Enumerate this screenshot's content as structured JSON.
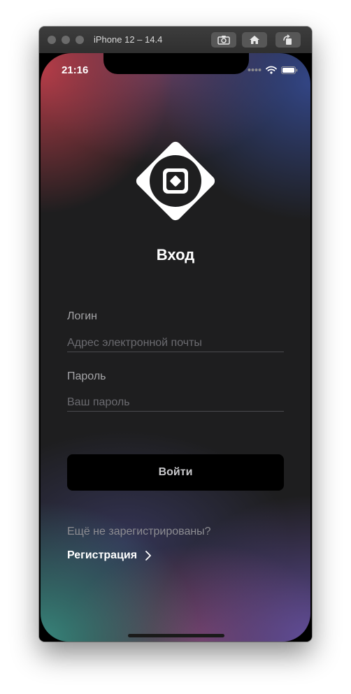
{
  "window": {
    "title": "iPhone 12 – 14.4",
    "screenshot_icon": "camera-icon",
    "home_icon": "home-icon",
    "rotate_icon": "rotate-icon"
  },
  "status_bar": {
    "time": "21:16",
    "icons": [
      "cellular-dots-icon",
      "wifi-icon",
      "battery-icon"
    ]
  },
  "login": {
    "logo_icon": "app-logo-icon",
    "heading": "Вход",
    "login_label": "Логин",
    "login_placeholder": "Адрес электронной почты",
    "login_value": "",
    "password_label": "Пароль",
    "password_placeholder": "Ваш пароль",
    "password_value": "",
    "submit_label": "Войти",
    "register_hint": "Ещё не зарегистрированы?",
    "register_label": "Регистрация"
  },
  "colors": {
    "background": "#1e1e1f",
    "button_bg": "#000000",
    "text_primary": "#ffffff",
    "text_secondary": "#a5a5a8",
    "placeholder": "#6b6b70"
  }
}
